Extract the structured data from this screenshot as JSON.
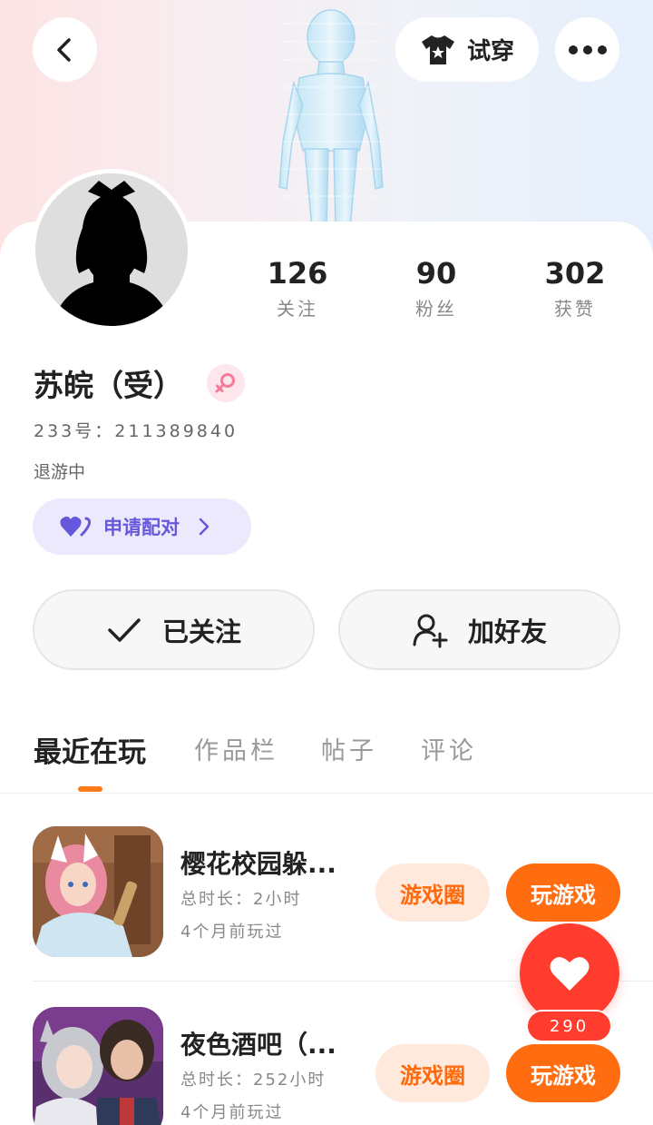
{
  "header": {
    "back_icon": "chevron-left-icon",
    "try_on_label": "试穿",
    "try_on_icon": "tshirt-star-icon",
    "more_icon": "more-dots-icon"
  },
  "profile": {
    "stats": [
      {
        "value": "126",
        "label": "关注"
      },
      {
        "value": "90",
        "label": "粉丝"
      },
      {
        "value": "302",
        "label": "获赞"
      }
    ],
    "name": "苏皖（受）",
    "gender_icon": "female-symbol-icon",
    "id_line": "233号：211389840",
    "status": "退游中",
    "pair_label": "申请配对",
    "pair_icon": "hearts-icon",
    "followed_label": "已关注",
    "add_friend_label": "加好友"
  },
  "tabs": [
    {
      "label": "最近在玩",
      "active": true
    },
    {
      "label": "作品栏",
      "active": false
    },
    {
      "label": "帖子",
      "active": false
    },
    {
      "label": "评论",
      "active": false
    }
  ],
  "games": [
    {
      "title": "樱花校园躲...",
      "duration": "总时长：2小时",
      "last_played": "4个月前玩过",
      "circle_label": "游戏圈",
      "play_label": "玩游戏"
    },
    {
      "title": "夜色酒吧（...",
      "duration": "总时长：252小时",
      "last_played": "4个月前玩过",
      "circle_label": "游戏圈",
      "play_label": "玩游戏"
    }
  ],
  "like": {
    "count": "290",
    "icon": "heart-icon"
  },
  "colors": {
    "accent_orange": "#ff6d10",
    "pair_purple": "#6658dd",
    "like_red": "#ff3c2e"
  }
}
